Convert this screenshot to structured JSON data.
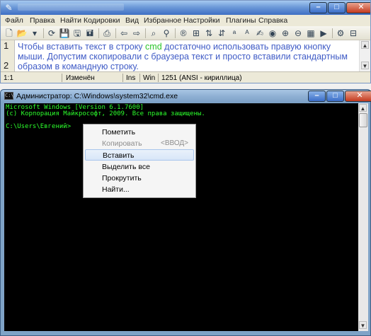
{
  "akelpad": {
    "menu": [
      "Файл",
      "Правка",
      "Найти",
      "Кодировки",
      "Вид",
      "Избранное",
      "Настройки",
      "Плагины",
      "Справка"
    ],
    "lines": [
      {
        "num": "1",
        "before": "Чтобы вставить текст в строку ",
        "highlight": "cmd",
        "after": " достаточно использовать  правую кнопку"
      },
      {
        "num": "",
        "text": "мыши. Допустим скопировали с браузера текст и просто вставили стандартным"
      },
      {
        "num": "2",
        "text": "образом в  командную строку."
      }
    ],
    "status": {
      "position": "1:1",
      "modified": "Изменён",
      "insert": "Ins",
      "newline": "Win",
      "encoding": "1251  (ANSI - кириллица)"
    }
  },
  "cmd": {
    "title": "Администратор: C:\\Windows\\system32\\cmd.exe",
    "console_lines": [
      "Microsoft Windows [Version 6.1.7600]",
      "(c) Корпорация Майкрософт, 2009. Все права защищены.",
      "",
      "C:\\Users\\Евгений>"
    ],
    "context_menu": [
      {
        "label": "Пометить",
        "enabled": true
      },
      {
        "label": "Копировать",
        "shortcut": "<ВВОД>",
        "enabled": false
      },
      {
        "label": "Вставить",
        "enabled": true,
        "highlighted": true
      },
      {
        "label": "Выделить все",
        "enabled": true
      },
      {
        "label": "Прокрутить",
        "enabled": true
      },
      {
        "label": "Найти...",
        "enabled": true
      }
    ]
  },
  "colors": {
    "editor_text": "#3f5bc6",
    "editor_highlight": "#2cc42c",
    "console_text": "#2cff2c",
    "console_bg": "#000000"
  }
}
